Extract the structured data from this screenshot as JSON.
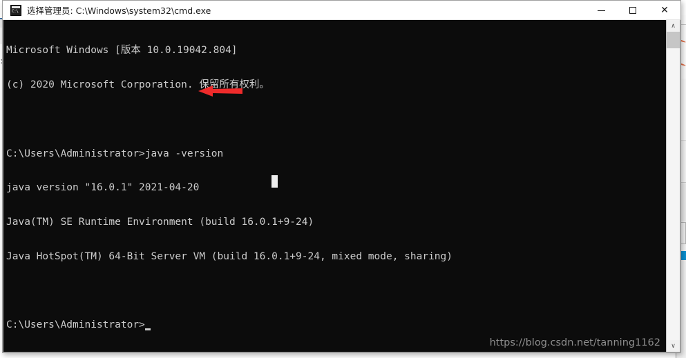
{
  "window": {
    "title": "选择管理员: C:\\Windows\\system32\\cmd.exe",
    "icon": "cmd-icon",
    "controls": {
      "minimize_label": "—",
      "maximize_label": "□",
      "close_label": "✕"
    }
  },
  "console": {
    "background_color": "#0c0c0c",
    "text_color": "#cccccc",
    "lines": [
      "Microsoft Windows [版本 10.0.19042.804]",
      "(c) 2020 Microsoft Corporation. 保留所有权利。",
      "",
      "C:\\Users\\Administrator>java -version",
      "java version \"16.0.1\" 2021-04-20",
      "Java(TM) SE Runtime Environment (build 16.0.1+9-24)",
      "Java HotSpot(TM) 64-Bit Server VM (build 16.0.1+9-24, mixed mode, sharing)",
      ""
    ],
    "prompt": "C:\\Users\\Administrator>",
    "command_entered": "java -version",
    "java_version": "16.0.1",
    "java_release_date": "2021-04-20",
    "java_build": "16.0.1+9-24",
    "windows_version": "10.0.19042.804"
  },
  "annotation": {
    "arrow_color": "#ee2b2b",
    "arrow_direction": "left",
    "points_at": "java version \"16.0.1\" 2021-04-20"
  },
  "scrollbar": {
    "up_arrow": "∧",
    "down_arrow": "∨"
  },
  "watermark": {
    "text": "https://blog.csdn.net/tanning1162",
    "color": "#8e8e8e"
  }
}
